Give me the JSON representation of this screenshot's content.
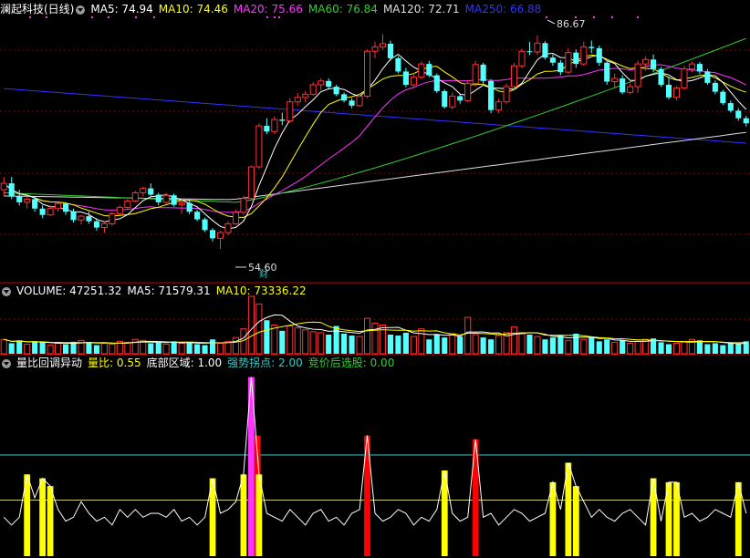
{
  "colors": {
    "up": "#ff3333",
    "down": "#54ffff",
    "ma5": "#ffffff",
    "ma10": "#ffff00",
    "ma20": "#ff33ff",
    "ma60": "#33cc33",
    "ma120": "#dddddd",
    "ma250": "#3333ff",
    "grid": "#880000",
    "yellow_bar": "#ffff00",
    "red_bar": "#ff0000",
    "magenta_bar": "#ff33ff",
    "cyan_line": "#33cccc"
  },
  "price_header": {
    "title": "澜起科技(日线)",
    "ma5": "MA5: 74.94",
    "ma10": "MA10: 74.46",
    "ma20": "MA20: 75.66",
    "ma60": "MA60: 76.84",
    "ma120": "MA120: 72.71",
    "ma250": "MA250: 66.88"
  },
  "volume_header": {
    "volume": "VOLUME: 47251.32",
    "ma5": "MA5: 71579.31",
    "ma10": "MA10: 73336.22"
  },
  "indicator_header": {
    "name": "量比回调异动",
    "liangbi": "量比: 0.55",
    "dibu": "底部区域: 1.00",
    "qiangshi": "强势拐点: 2.00",
    "jingjia": "竞价后选股: 0.00"
  },
  "annotations": {
    "high_label": "86.67",
    "low_label": "54.60",
    "cai_marker": "财"
  },
  "chart_data": {
    "type": "candlestick",
    "title": "澜起科技(日线)",
    "ylim": [
      50,
      92
    ],
    "candles": [
      [
        64,
        66,
        63,
        65
      ],
      [
        65,
        66,
        62.5,
        63
      ],
      [
        63,
        64,
        61.5,
        62
      ],
      [
        62,
        63,
        61,
        62.5
      ],
      [
        62.5,
        62.8,
        60.5,
        61
      ],
      [
        61,
        61.5,
        59.5,
        60
      ],
      [
        60,
        61.5,
        59.8,
        61
      ],
      [
        61,
        62,
        60.5,
        61.8
      ],
      [
        61.8,
        62,
        60,
        60.5
      ],
      [
        60.5,
        61,
        58.8,
        59.2
      ],
      [
        59.2,
        60,
        58.5,
        59.8
      ],
      [
        59.8,
        60.5,
        58.6,
        59
      ],
      [
        59,
        59.5,
        57.5,
        58
      ],
      [
        58,
        59,
        57.2,
        58.6
      ],
      [
        58.6,
        60.5,
        58.3,
        60.2
      ],
      [
        60.2,
        61.5,
        60,
        61.2
      ],
      [
        61.2,
        62.5,
        60.8,
        62.2
      ],
      [
        62.2,
        63.8,
        62,
        63.5
      ],
      [
        63.5,
        64.5,
        63,
        64.2
      ],
      [
        64.2,
        65,
        62.8,
        63.2
      ],
      [
        63.2,
        63.5,
        61.5,
        62
      ],
      [
        62,
        63.5,
        61.8,
        63.1
      ],
      [
        63.1,
        63.4,
        61.3,
        61.6
      ],
      [
        61.6,
        62.5,
        60.2,
        61.9
      ],
      [
        61.9,
        62.3,
        60.1,
        60.5
      ],
      [
        60.5,
        60.8,
        59,
        59.3
      ],
      [
        59.3,
        59.6,
        57.3,
        57.6
      ],
      [
        57.6,
        57.9,
        55.8,
        56.3
      ],
      [
        56.3,
        57.5,
        54.6,
        57.2
      ],
      [
        57.2,
        59,
        56.8,
        58.6
      ],
      [
        58.6,
        60.8,
        58.4,
        60.4
      ],
      [
        60.4,
        63,
        60,
        62.6
      ],
      [
        62.6,
        67.8,
        62.4,
        67.6
      ],
      [
        67.6,
        74.5,
        67.3,
        74.1
      ],
      [
        74.1,
        75.3,
        72.8,
        73.2
      ],
      [
        73.2,
        75.6,
        72.8,
        75.1
      ],
      [
        75.1,
        76.2,
        74.2,
        74.9
      ],
      [
        74.9,
        78.5,
        74.6,
        77.9
      ],
      [
        77.9,
        79.3,
        77.3,
        78.6
      ],
      [
        78.6,
        79.6,
        77.8,
        79.1
      ],
      [
        79.1,
        81,
        78.9,
        80.6
      ],
      [
        80.6,
        81.6,
        79.7,
        81.2
      ],
      [
        81.2,
        81.6,
        80,
        80.3
      ],
      [
        80.3,
        80.6,
        78.8,
        79.1
      ],
      [
        79.1,
        79.4,
        77.8,
        78.1
      ],
      [
        78.1,
        78.5,
        76.9,
        77.3
      ],
      [
        77.3,
        79.1,
        77.1,
        78.8
      ],
      [
        78.8,
        86.2,
        78.5,
        85.9
      ],
      [
        85.9,
        87.4,
        84.8,
        86.6
      ],
      [
        86.6,
        88.6,
        86.1,
        87.1
      ],
      [
        87.1,
        87.6,
        84.4,
        84.8
      ],
      [
        84.8,
        85.1,
        82.4,
        82.7
      ],
      [
        82.7,
        83.3,
        80.2,
        80.6
      ],
      [
        80.6,
        82.4,
        80.2,
        81.8
      ],
      [
        81.8,
        84.3,
        81.5,
        83.9
      ],
      [
        83.9,
        84.4,
        81.8,
        82.1
      ],
      [
        82.1,
        82.4,
        79.3,
        79.6
      ],
      [
        79.6,
        79.9,
        76.8,
        77.1
      ],
      [
        77.1,
        79.4,
        76.7,
        78.8
      ],
      [
        78.8,
        79.1,
        77.6,
        78.1
      ],
      [
        78.1,
        81.3,
        77.8,
        80.8
      ],
      [
        80.8,
        84.4,
        80.3,
        83.8
      ],
      [
        83.8,
        84.1,
        80.8,
        81.2
      ],
      [
        81.2,
        81.5,
        76.1,
        76.6
      ],
      [
        76.6,
        78.4,
        76.1,
        77.9
      ],
      [
        77.9,
        80.8,
        77.6,
        80.3
      ],
      [
        80.3,
        84.1,
        79.8,
        83.6
      ],
      [
        83.6,
        86.3,
        83.2,
        85.9
      ],
      [
        85.9,
        87.4,
        85.3,
        85.8
      ],
      [
        85.8,
        88.4,
        85.3,
        87.2
      ],
      [
        87.2,
        87.5,
        84.6,
        84.9
      ],
      [
        84.9,
        85.4,
        83.6,
        84.1
      ],
      [
        84.1,
        84.5,
        82.1,
        82.6
      ],
      [
        82.6,
        86.4,
        82.3,
        85.7
      ],
      [
        85.7,
        86.2,
        83.3,
        83.9
      ],
      [
        83.9,
        87.4,
        83.6,
        86.6
      ],
      [
        86.6,
        87.6,
        85.6,
        86.4
      ],
      [
        86.4,
        86.8,
        83.6,
        84.1
      ],
      [
        84.1,
        84.5,
        80.6,
        81.1
      ],
      [
        81.1,
        82.4,
        80.1,
        81.6
      ],
      [
        81.6,
        82.1,
        79.1,
        79.4
      ],
      [
        79.4,
        80.8,
        79.1,
        80.3
      ],
      [
        80.3,
        84.4,
        79.3,
        83.9
      ],
      [
        83.9,
        85.1,
        82.8,
        84.6
      ],
      [
        84.6,
        85.4,
        82.6,
        83.1
      ],
      [
        83.1,
        83.4,
        80.3,
        80.6
      ],
      [
        80.6,
        81.9,
        78.3,
        78.6
      ],
      [
        78.6,
        80.4,
        78.1,
        80.1
      ],
      [
        80.1,
        83.6,
        79.8,
        83.1
      ],
      [
        83.1,
        84.3,
        82.6,
        83.9
      ],
      [
        83.9,
        84.2,
        82.3,
        82.7
      ],
      [
        82.7,
        83.1,
        80.6,
        80.9
      ],
      [
        80.9,
        81.3,
        79.1,
        79.5
      ],
      [
        79.5,
        79.8,
        77.4,
        77.7
      ],
      [
        77.7,
        78.1,
        76.2,
        76.5
      ],
      [
        76.5,
        76.9,
        74.9,
        75.3
      ],
      [
        75.3,
        75.7,
        74.0,
        74.5
      ]
    ],
    "ma_last": {
      "MA5": 74.94,
      "MA10": 74.46,
      "MA20": 75.66,
      "MA60": 76.84,
      "MA120": 72.71,
      "MA250": 66.88
    },
    "volume": [
      30,
      22,
      28,
      20,
      26,
      24,
      18,
      22,
      20,
      25,
      28,
      24,
      18,
      22,
      20,
      26,
      24,
      30,
      28,
      22,
      24,
      20,
      26,
      22,
      24,
      20,
      18,
      30,
      22,
      26,
      34,
      52,
      120,
      104,
      70,
      60,
      48,
      58,
      54,
      50,
      46,
      44,
      40,
      58,
      42,
      38,
      36,
      74,
      64,
      60,
      40,
      38,
      44,
      36,
      52,
      30,
      40,
      34,
      42,
      36,
      76,
      40,
      34,
      30,
      38,
      44,
      56,
      42,
      40,
      36,
      30,
      34,
      38,
      28,
      42,
      30,
      34,
      26,
      30,
      24,
      28,
      22,
      26,
      30,
      32,
      24,
      20,
      22,
      26,
      30,
      28,
      20,
      22,
      18,
      24,
      20,
      26
    ],
    "indicator": [
      0.5,
      0.4,
      0.5,
      1.05,
      0.75,
      1.0,
      0.9,
      0.6,
      0.45,
      0.5,
      0.7,
      0.55,
      0.45,
      0.5,
      0.4,
      0.6,
      0.5,
      0.6,
      0.5,
      0.55,
      0.55,
      0.5,
      0.6,
      0.45,
      0.5,
      0.4,
      0.5,
      1.0,
      0.55,
      0.6,
      0.7,
      1.05,
      2.3,
      1.05,
      0.55,
      0.5,
      0.45,
      0.6,
      0.5,
      0.4,
      0.55,
      0.6,
      0.45,
      0.5,
      0.4,
      0.55,
      0.6,
      1.55,
      0.55,
      0.45,
      0.5,
      0.6,
      0.55,
      0.4,
      0.5,
      0.45,
      0.6,
      1.1,
      0.55,
      0.45,
      0.5,
      1.5,
      0.5,
      0.55,
      0.4,
      0.5,
      0.6,
      0.55,
      0.45,
      0.5,
      0.55,
      0.95,
      0.6,
      1.2,
      0.9,
      0.7,
      0.5,
      0.6,
      0.5,
      0.45,
      0.55,
      0.6,
      0.5,
      0.4,
      1.0,
      0.45,
      0.95,
      0.95,
      0.5,
      0.55,
      0.45,
      0.5,
      0.6,
      0.55,
      0.5,
      0.95,
      0.55
    ],
    "indicator_levels": {
      "upper": 1.3,
      "lower": 0.72
    }
  }
}
